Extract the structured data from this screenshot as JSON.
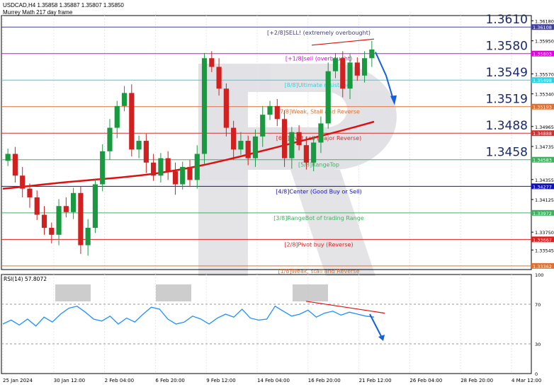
{
  "header": {
    "symbol_line": "USDCAD,H4  1.35858 1.35887 1.35807 1.35850",
    "indicator_name": "Murrey Math 217 day frame"
  },
  "rsi": {
    "label": "RSI(14) 57.8072",
    "levels": [
      70,
      30
    ],
    "ticks": [
      "100",
      "70",
      "30",
      "0"
    ]
  },
  "price_ticks": [
    "1.36180",
    "1.35950",
    "1.35570",
    "1.35340",
    "1.34965",
    "1.34735",
    "1.34355",
    "1.34125",
    "1.33750",
    "1.33545"
  ],
  "murrey_levels": [
    {
      "price": "1.36108",
      "label": "",
      "color": "#4040a0",
      "big": "1.3610"
    },
    {
      "price": "1.36100",
      "label": "[+2/8]SELL! (extremely overbought)",
      "color": "#404080",
      "big": ""
    },
    {
      "price": "1.35803",
      "label": "[+1/8]sell (overbought)",
      "color": "#e000e0",
      "big": "1.3580"
    },
    {
      "price": "1.35498",
      "label": "[8/8]Ultimate resistance",
      "color": "#30d0e0",
      "big": "1.3549"
    },
    {
      "price": "1.35193",
      "label": "[7/8]Weak, Stall and Reverse",
      "color": "#e07030",
      "big": "1.3519"
    },
    {
      "price": "1.34888",
      "label": "[6/8]Pivot sell (Major Reverse)",
      "color": "#d03030",
      "big": "1.3488"
    },
    {
      "price": "1.34583",
      "label": "[5/8]RangeTop",
      "color": "#40b060",
      "big": "1.3458"
    },
    {
      "price": "1.34277",
      "label": "[4/8]Center (Good Buy or Sell)",
      "color": "#1010c0",
      "big": ""
    },
    {
      "price": "1.33972",
      "label": "[3/8]RangeBot of trading Range",
      "color": "#40b060",
      "big": ""
    },
    {
      "price": "1.33667",
      "label": "[2/8]Pivot buy (Reverse)",
      "color": "#e02020",
      "big": ""
    },
    {
      "price": "1.33362",
      "label": "[1/8]Weak, stall and Reverse",
      "color": "#e07030",
      "big": ""
    }
  ],
  "x_labels": [
    "25 Jan 2024",
    "30 Jan 12:00",
    "2 Feb 04:00",
    "6 Feb 20:00",
    "9 Feb 12:00",
    "14 Feb 04:00",
    "16 Feb 20:00",
    "21 Feb 12:00",
    "26 Feb 04:00",
    "28 Feb 20:00",
    "4 Mar 12:00"
  ],
  "chart_data": {
    "type": "candlestick",
    "symbol": "USDCAD",
    "timeframe": "H4",
    "last_price": 1.3585,
    "ylim": [
      1.3332,
      1.3624
    ],
    "ma_color": "#e01010",
    "ma_start": 1.3425,
    "ma_end": 1.3502,
    "close_path": [
      1.3465,
      1.344,
      1.3425,
      1.3415,
      1.3395,
      1.338,
      1.3372,
      1.3405,
      1.3398,
      1.342,
      1.336,
      1.338,
      1.343,
      1.3468,
      1.3495,
      1.352,
      1.3535,
      1.347,
      1.348,
      1.3455,
      1.344,
      1.346,
      1.3445,
      1.343,
      1.345,
      1.3435,
      1.3465,
      1.3575,
      1.3565,
      1.354,
      1.3495,
      1.347,
      1.348,
      1.346,
      1.3485,
      1.351,
      1.352,
      1.3505,
      1.346,
      1.349,
      1.3475,
      1.3455,
      1.3478,
      1.35,
      1.356,
      1.3575,
      1.354,
      1.357,
      1.3555,
      1.3575,
      1.3585
    ],
    "rsi_values": [
      50,
      54,
      49,
      55,
      48,
      57,
      52,
      60,
      66,
      68,
      62,
      55,
      53,
      58,
      50,
      56,
      52,
      60,
      67,
      65,
      55,
      50,
      52,
      58,
      55,
      50,
      56,
      60,
      57,
      65,
      56,
      54,
      55,
      68,
      63,
      58,
      60,
      64,
      57,
      61,
      63,
      59,
      62,
      60,
      58,
      57
    ]
  }
}
